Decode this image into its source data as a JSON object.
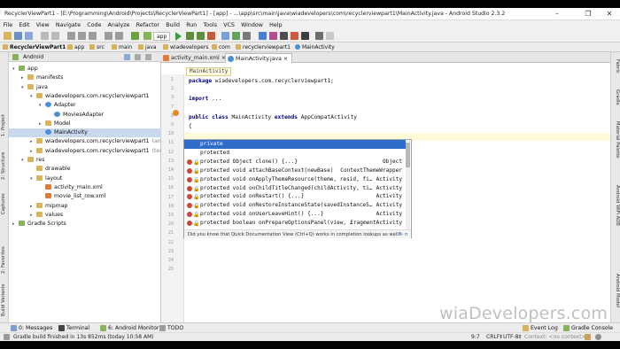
{
  "window": {
    "title": "RecyclerViewPart1 - [E:\\Programming\\Android\\Projects\\RecyclerViewPart1] - [app] - ...\\app\\src\\main\\java\\wiadevelopers\\com\\recyclerviewpart1\\MainActivity.java - Android Studio 2.3.2",
    "minimize": "–",
    "maximize": "❐",
    "close": "✕"
  },
  "menu": [
    "File",
    "Edit",
    "View",
    "Navigate",
    "Code",
    "Analyze",
    "Refactor",
    "Build",
    "Run",
    "Tools",
    "VCS",
    "Window",
    "Help"
  ],
  "toolbar": {
    "module": "app"
  },
  "breadcrumbs": [
    "RecyclerViewPart1",
    "app",
    "src",
    "main",
    "java",
    "wiadevelopers",
    "com",
    "recyclerviewpart1",
    "MainActivity"
  ],
  "left_tabs": [
    "1: Project",
    "2: Structure",
    "Captures",
    "2: Favorites",
    "Build Variants"
  ],
  "right_tabs": [
    "Fabric",
    "Gradle",
    "Material Palette",
    "Android WiFi ADB",
    "Android Model"
  ],
  "project": {
    "view": "Android",
    "nodes": [
      {
        "label": "app",
        "hint": "",
        "level": 0,
        "arrow": "▾"
      },
      {
        "label": "manifests",
        "hint": "",
        "level": 1,
        "arrow": "▸"
      },
      {
        "label": "java",
        "hint": "",
        "level": 1,
        "arrow": "▾"
      },
      {
        "label": "wiadevelopers.com.recyclerviewpart1",
        "hint": "",
        "level": 2,
        "arrow": "▾"
      },
      {
        "label": "Adapter",
        "hint": "",
        "level": 3,
        "arrow": "▾"
      },
      {
        "label": "MoviesAdapter",
        "hint": "",
        "level": 4,
        "arrow": ""
      },
      {
        "label": "Model",
        "hint": "",
        "level": 3,
        "arrow": "▸"
      },
      {
        "label": "MainActivity",
        "hint": "",
        "level": 3,
        "arrow": "",
        "selected": true
      },
      {
        "label": "wiadevelopers.com.recyclerviewpart1",
        "hint": "(androidTest)",
        "level": 2,
        "arrow": "▸"
      },
      {
        "label": "wiadevelopers.com.recyclerviewpart1",
        "hint": "(test)",
        "level": 2,
        "arrow": "▸"
      },
      {
        "label": "res",
        "hint": "",
        "level": 1,
        "arrow": "▾"
      },
      {
        "label": "drawable",
        "hint": "",
        "level": 2,
        "arrow": ""
      },
      {
        "label": "layout",
        "hint": "",
        "level": 2,
        "arrow": "▾"
      },
      {
        "label": "activity_main.xml",
        "hint": "",
        "level": 3,
        "arrow": ""
      },
      {
        "label": "movie_list_row.xml",
        "hint": "",
        "level": 3,
        "arrow": ""
      },
      {
        "label": "mipmap",
        "hint": "",
        "level": 2,
        "arrow": "▸"
      },
      {
        "label": "values",
        "hint": "",
        "level": 2,
        "arrow": "▸"
      },
      {
        "label": "Gradle Scripts",
        "hint": "",
        "level": 0,
        "arrow": "▸"
      }
    ]
  },
  "editor": {
    "tabs": [
      "activity_main.xml",
      "MainActivity.java"
    ],
    "crumb": "MainActivity",
    "lines": [
      {
        "n": "1",
        "text": "package wiadevelopers.com.recyclerviewpart1;"
      },
      {
        "n": "2",
        "text": ""
      },
      {
        "n": "3",
        "text": "import ..."
      },
      {
        "n": "7",
        "text": ""
      },
      {
        "n": "8",
        "text": "public class MainActivity extends AppCompatActivity"
      },
      {
        "n": "9",
        "text": "{"
      },
      {
        "n": "10",
        "text": ""
      },
      {
        "n": "11",
        "text": "    pr"
      },
      {
        "n": "12",
        "text": ""
      },
      {
        "n": "13",
        "text": ""
      },
      {
        "n": "14",
        "text": ""
      },
      {
        "n": "15",
        "text": ""
      },
      {
        "n": "16",
        "text": ""
      },
      {
        "n": "17",
        "text": ""
      },
      {
        "n": "18",
        "text": ""
      },
      {
        "n": "19",
        "text": ""
      },
      {
        "n": "20",
        "text": ""
      },
      {
        "n": "21",
        "text": ""
      },
      {
        "n": "22",
        "text": ""
      },
      {
        "n": "23",
        "text": ""
      },
      {
        "n": "24",
        "text": ""
      },
      {
        "n": "25",
        "text": ""
      }
    ]
  },
  "completion": {
    "items": [
      {
        "sig": "private",
        "type": "",
        "icon": false
      },
      {
        "sig": "protected",
        "type": "",
        "icon": false
      },
      {
        "sig": "protected Object clone() {...}",
        "type": "Object",
        "icon": true
      },
      {
        "sig": "protected void attachBaseContext(newBase)",
        "type": "ContextThemeWrapper",
        "icon": true
      },
      {
        "sig": "protected void onApplyThemeResource(theme, resid, fi…",
        "type": "Activity",
        "icon": true
      },
      {
        "sig": "protected void onChildTitleChanged(childActivity, ti…",
        "type": "Activity",
        "icon": true
      },
      {
        "sig": "protected void onRestart() {...}",
        "type": "Activity",
        "icon": true
      },
      {
        "sig": "protected void onRestoreInstanceState(savedInstanceS…",
        "type": "Activity",
        "icon": true
      },
      {
        "sig": "protected void onUserLeaveHint() {...}",
        "type": "Activity",
        "icon": true
      },
      {
        "sig": "protected boolean onPrepareOptionsPanel(view, …",
        "type": "FragmentActivity",
        "icon": true
      }
    ],
    "footer": "Did you know that Quick Documentation View (Ctrl+Q) works in completion lookups as well?",
    "footer_link": "≫ π"
  },
  "toolwindows": [
    "0: Messages",
    "Terminal",
    "6: Android Monitor",
    "TODO"
  ],
  "toolwindows_right": [
    "Event Log",
    "Gradle Console"
  ],
  "status": {
    "message": "Gradle build finished in 13s 852ms (today 10:58 AM)",
    "position": "9:7",
    "line_sep": "CRLF‡",
    "encoding": "UTF-8‡",
    "context": "Context: <no context>"
  },
  "watermark": "wiaDevelopers.com",
  "colors": {
    "accent": "#2f6ec8",
    "selection": "#c9d7ef"
  }
}
